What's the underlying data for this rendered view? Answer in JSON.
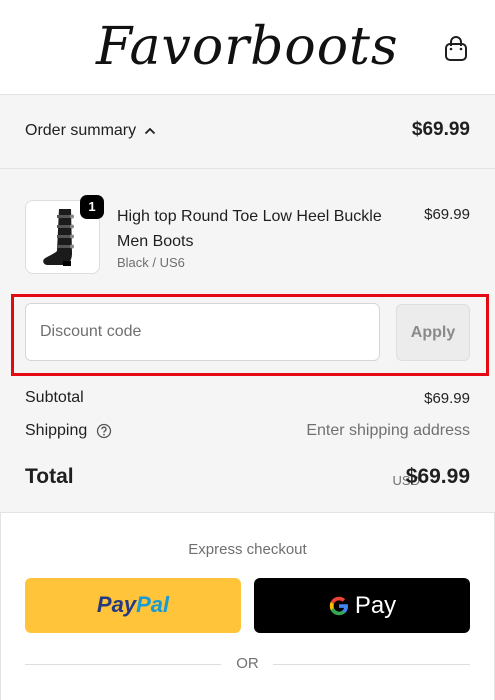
{
  "header": {
    "logo_text": "Favorboots",
    "cart_icon": "shopping-bag-icon"
  },
  "summary": {
    "toggle_label": "Order summary",
    "toggle_icon": "chevron-up-icon",
    "total": "$69.99"
  },
  "product": {
    "name": "High top Round Toe Low Heel Buckle Men Boots",
    "variant": "Black / US6",
    "price": "$69.99",
    "quantity": "1"
  },
  "discount": {
    "placeholder": "Discount code",
    "value": "",
    "apply_label": "Apply"
  },
  "totals": {
    "subtotal_label": "Subtotal",
    "subtotal_value": "$69.99",
    "shipping_label": "Shipping",
    "shipping_value": "Enter shipping address",
    "total_label": "Total",
    "currency": "USD",
    "total_value": "$69.99"
  },
  "express": {
    "title": "Express checkout",
    "paypal_part1": "Pay",
    "paypal_part2": "Pal",
    "gpay_label": "Pay",
    "or_text": "OR"
  },
  "colors": {
    "highlight": "#e50914",
    "paypal_yellow": "#ffc439",
    "paypal_dark_blue": "#253b80",
    "paypal_light_blue": "#179bd7",
    "gpay_black": "#000000"
  }
}
